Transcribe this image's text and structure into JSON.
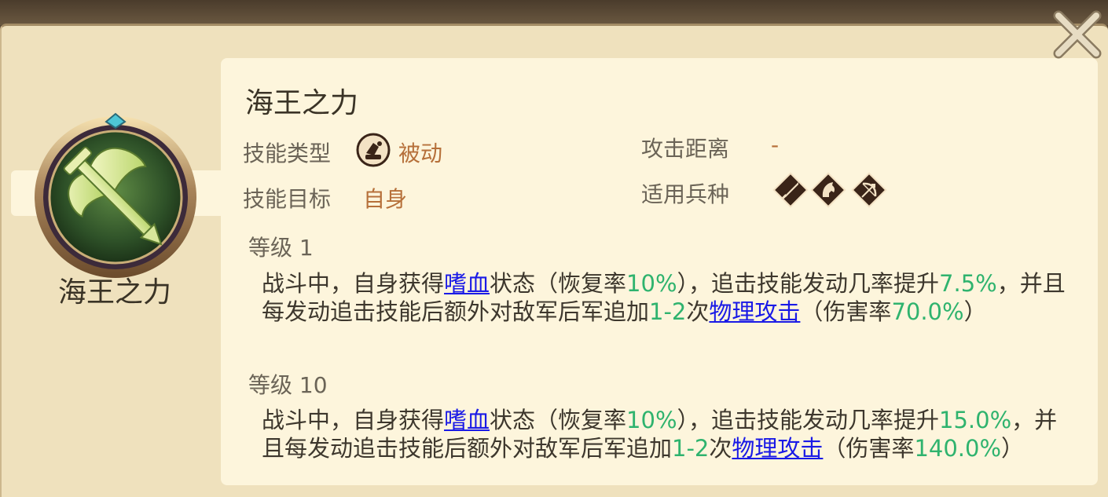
{
  "skill": {
    "name": "海王之力",
    "title": "海王之力"
  },
  "info": {
    "type_label": "技能类型",
    "type_value": "被动",
    "target_label": "技能目标",
    "target_value": "自身",
    "range_label": "攻击距离",
    "range_value": "-",
    "troops_label": "适用兵种",
    "troop_icons": [
      "sword-troop-icon",
      "horse-troop-icon",
      "bow-troop-icon"
    ]
  },
  "levels": [
    {
      "label": "等级 1",
      "desc": {
        "p1": "战斗中，自身获得",
        "link1": "嗜血",
        "p2": "状态（恢复率",
        "v1": "10%",
        "p3": "），追击技能发动几率提升",
        "v2": "7.5%",
        "p4": "，并且每发动追击技能后额外对敌军后军追加",
        "v3": "1-2",
        "p5": "次",
        "link2": "物理攻击",
        "p6": "（伤害率",
        "v4": "70.0%",
        "p7": "）"
      }
    },
    {
      "label": "等级 10",
      "desc": {
        "p1": "战斗中，自身获得",
        "link1": "嗜血",
        "p2": "状态（恢复率",
        "v1": "10%",
        "p3": "），追击技能发动几率提升",
        "v2": "15.0%",
        "p4": "，并且每发动追击技能后额外对敌军后军追加",
        "v3": "1-2",
        "p5": "次",
        "link2": "物理攻击",
        "p6": "（伤害率",
        "v4": "140.0%",
        "p7": "）"
      }
    }
  ],
  "colors": {
    "highlight_green": "#2fb36e",
    "link_blue": "#1a1ae6",
    "value_orange": "#b6703a"
  }
}
